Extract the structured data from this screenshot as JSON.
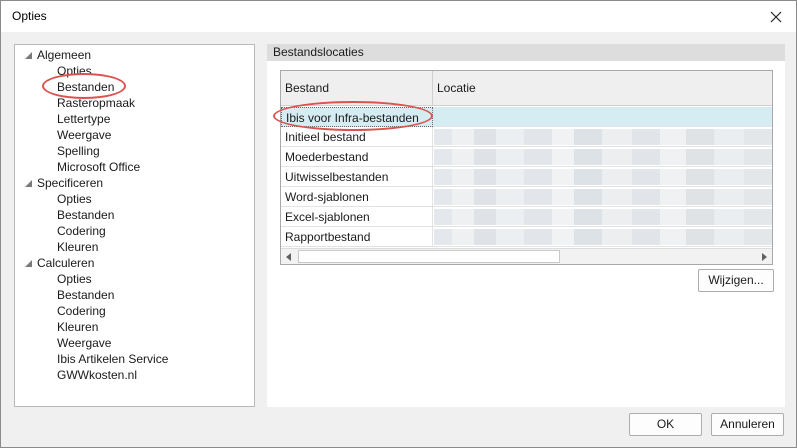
{
  "window": {
    "title": "Opties"
  },
  "tree": {
    "groups": [
      {
        "label": "Algemeen",
        "children": [
          "Opties",
          "Bestanden",
          "Rasteropmaak",
          "Lettertype",
          "Weergave",
          "Spelling",
          "Microsoft Office"
        ]
      },
      {
        "label": "Specificeren",
        "children": [
          "Opties",
          "Bestanden",
          "Codering",
          "Kleuren"
        ]
      },
      {
        "label": "Calculeren",
        "children": [
          "Opties",
          "Bestanden",
          "Codering",
          "Kleuren",
          "Weergave",
          "Ibis Artikelen Service",
          "GWWkosten.nl"
        ]
      }
    ]
  },
  "panel": {
    "title": "Bestandslocaties",
    "columns": [
      "Bestand",
      "Locatie"
    ],
    "rows": [
      {
        "bestand": "Ibis voor Infra-bestanden",
        "selected": true
      },
      {
        "bestand": "Initieel bestand"
      },
      {
        "bestand": "Moederbestand"
      },
      {
        "bestand": "Uitwisselbestanden"
      },
      {
        "bestand": "Word-sjablonen"
      },
      {
        "bestand": "Excel-sjablonen"
      },
      {
        "bestand": "Rapportbestand"
      }
    ],
    "change_button": "Wijzigen..."
  },
  "footer": {
    "ok": "OK",
    "cancel": "Annuleren"
  },
  "colors": {
    "selection": "#d6ecf3",
    "annotation": "#d9534f"
  }
}
